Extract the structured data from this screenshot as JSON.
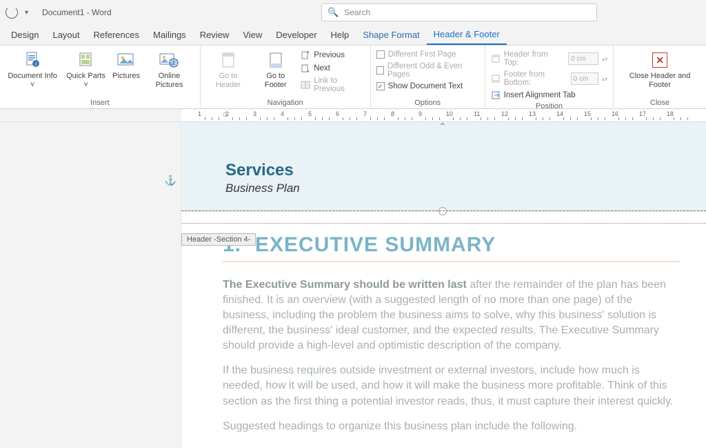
{
  "titlebar": {
    "title": "Document1 - Word",
    "search_placeholder": "Search"
  },
  "tabs": [
    "Design",
    "Layout",
    "References",
    "Mailings",
    "Review",
    "View",
    "Developer",
    "Help",
    "Shape Format",
    "Header & Footer"
  ],
  "active_tab": "Header & Footer",
  "context_tab": "Shape Format",
  "ribbon": {
    "insert": {
      "label": "Insert",
      "doc_info": "Document Info ˅",
      "quick_parts": "Quick Parts ˅",
      "pictures": "Pictures",
      "online_pictures": "Online Pictures"
    },
    "navigation": {
      "label": "Navigation",
      "goto_header": "Go to Header",
      "goto_footer": "Go to Footer",
      "previous": "Previous",
      "next": "Next",
      "link_prev": "Link to Previous"
    },
    "options": {
      "label": "Options",
      "diff_first": "Different First Page",
      "diff_oe": "Different Odd & Even Pages",
      "show_doc": "Show Document Text",
      "show_doc_checked": true
    },
    "position": {
      "label": "Position",
      "header_top": "Header from Top:",
      "footer_bottom": "Footer from Bottom:",
      "value": "0 cm",
      "insert_align": "Insert Alignment Tab"
    },
    "close": {
      "label": "Close",
      "btn": "Close Header and Footer"
    }
  },
  "ruler_numbers": [
    1,
    2,
    3,
    4,
    5,
    6,
    7,
    8,
    9,
    10,
    11,
    12,
    13,
    14,
    15,
    16,
    17,
    18
  ],
  "document": {
    "section_label": "Header -Section 4-",
    "header": {
      "title": "Services",
      "subtitle": "Business Plan"
    },
    "heading_no": "1.",
    "heading": "EXECUTIVE SUMMARY",
    "p1_bold": "The Executive Summary should be written last",
    "p1_rest": " after the remainder of the plan has been finished. It is an overview (with a suggested length of no more than one page) of the business, including the problem the business aims to solve, why this business' solution is different, the business' ideal customer, and the expected results. The Executive Summary should provide a high-level and optimistic description of the company.",
    "p2": "If the business requires outside investment or external investors, include how much is needed, how it will be used, and how it will make the business more profitable. Think of this section as the first thing a potential investor reads, thus, it must capture their interest quickly.",
    "p3": "Suggested headings to organize this business plan include the following."
  }
}
